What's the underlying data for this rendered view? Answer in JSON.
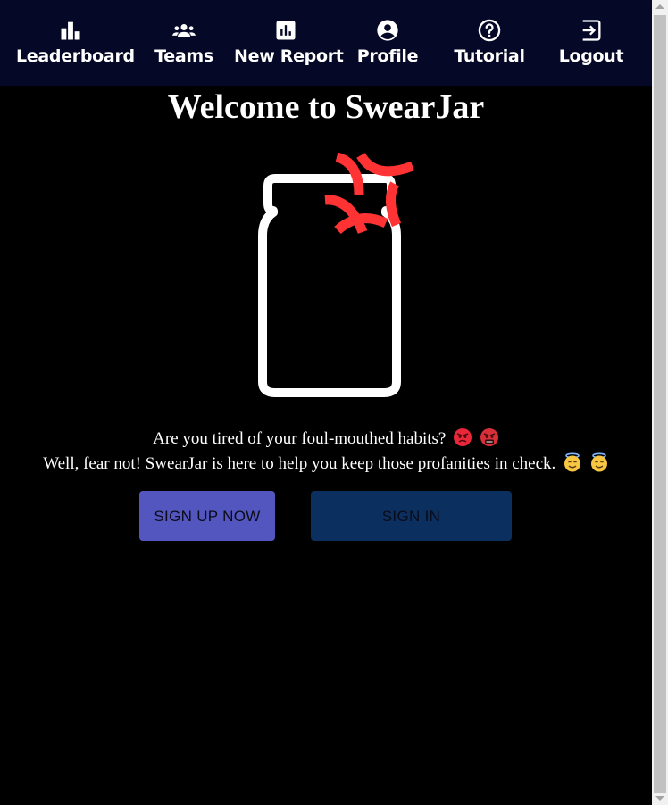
{
  "nav": {
    "items": [
      {
        "label": "Leaderboard",
        "icon": "leaderboard-icon"
      },
      {
        "label": "Teams",
        "icon": "groups-icon"
      },
      {
        "label": "New Report",
        "icon": "report-icon"
      },
      {
        "label": "Profile",
        "icon": "account-circle-icon"
      },
      {
        "label": "Tutorial",
        "icon": "help-icon"
      },
      {
        "label": "Logout",
        "icon": "logout-icon"
      }
    ]
  },
  "main": {
    "title": "Welcome to SwearJar",
    "tagline_line1": "Are you tired of your foul-mouthed habits?",
    "tagline_line2": "Well, fear not! SwearJar is here to help you keep those profanities in check.",
    "signup_label": "SIGN UP NOW",
    "signin_label": "SIGN IN"
  },
  "colors": {
    "navbar_bg": "#050826",
    "page_bg": "#000000",
    "anger_red": "#ff3333",
    "signup_bg": "#5356bf",
    "signin_bg": "#0b2f5e"
  }
}
